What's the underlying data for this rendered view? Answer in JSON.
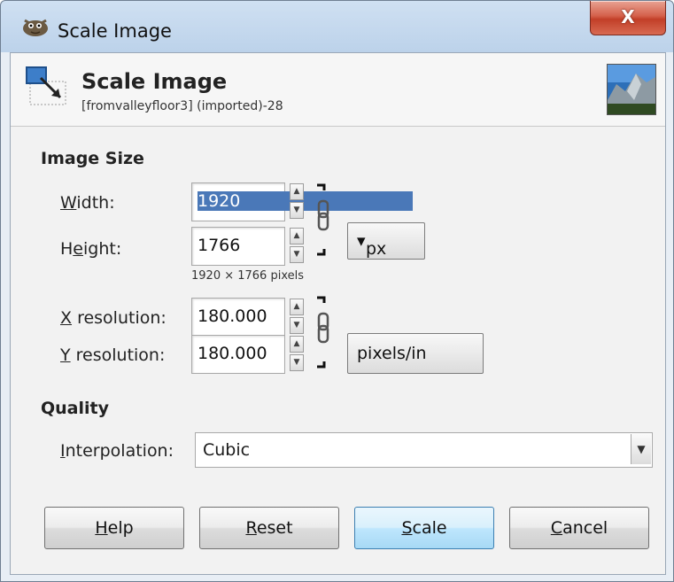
{
  "window": {
    "title": "Scale Image",
    "close_label": "X"
  },
  "header": {
    "title": "Scale Image",
    "subtitle": "[fromvalleyfloor3] (imported)-28"
  },
  "image_size": {
    "section_title": "Image Size",
    "width_label_mnemonic": "W",
    "width_label_rest": "idth:",
    "width_value": "1920",
    "height_label_pre": "H",
    "height_label_mnemonic": "e",
    "height_label_rest": "ight:",
    "height_value": "1766",
    "size_unit": "px",
    "pixels_hint": "1920 × 1766 pixels",
    "xres_label_mnemonic": "X",
    "xres_label_rest": " resolution:",
    "xres_value": "180.000",
    "yres_label_mnemonic": "Y",
    "yres_label_rest": " resolution:",
    "yres_value": "180.000",
    "res_unit": "pixels/in"
  },
  "quality": {
    "section_title": "Quality",
    "interp_label_mnemonic": "I",
    "interp_label_rest": "nterpolation:",
    "interp_value": "Cubic"
  },
  "buttons": {
    "help_mnemonic": "H",
    "help_rest": "elp",
    "reset_mnemonic": "R",
    "reset_rest": "eset",
    "scale_mnemonic": "S",
    "scale_rest": "cale",
    "cancel_mnemonic": "C",
    "cancel_rest": "ancel"
  }
}
